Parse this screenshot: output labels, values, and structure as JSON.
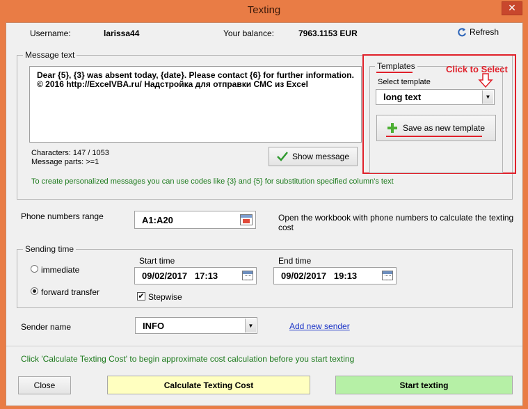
{
  "window": {
    "title": "Texting",
    "close_glyph": "✕"
  },
  "header": {
    "username_label": "Username:",
    "username": "larissa44",
    "balance_label": "Your balance:",
    "balance": "7963.1153 EUR",
    "refresh_label": "Refresh"
  },
  "message": {
    "group_label": "Message text",
    "text": "Dear {5}, {3} was absent today, {date}. Please contact {6} for further information. © 2016 http://ExcelVBA.ru/ Надстройка для отправки СМС из Excel",
    "characters": "Characters: 147 / 1053",
    "parts": "Message parts: >=1",
    "show_button": "Show message",
    "hint": "To create personalized messages you can use codes like {3} and {5} for substitution specified column's text"
  },
  "templates": {
    "group_label": "Templates",
    "select_label": "Select template",
    "selected": "long text",
    "save_button": "Save as new template",
    "annotation": "Click to Select"
  },
  "phones": {
    "label": "Phone numbers range",
    "value": "A1:A20",
    "hint": "Open the workbook with phone numbers to calculate the texting cost"
  },
  "sending": {
    "group_label": "Sending time",
    "immediate": "immediate",
    "forward": "forward transfer",
    "selected": "forward",
    "start_label": "Start time",
    "start_value": "09/02/2017   17:13",
    "end_label": "End time",
    "end_value": "09/02/2017   19:13",
    "stepwise": "Stepwise",
    "stepwise_checked": true
  },
  "sender": {
    "label": "Sender name",
    "value": "INFO",
    "add_link": "Add new sender"
  },
  "footer": {
    "hint": "Click 'Calculate Texting Cost' to begin approximate cost calculation before you start texting",
    "close_button": "Close",
    "calculate_button": "Calculate Texting Cost",
    "start_button": "Start texting"
  },
  "colors": {
    "title_bar": "#e97c45",
    "annotation_red": "#e0202a",
    "calculate_bg": "#ffffc0",
    "start_bg": "#b6f0a6",
    "hint_green": "#1c7a1c"
  },
  "icons": [
    "close-icon",
    "refresh-icon",
    "checkmark-icon",
    "plus-icon",
    "calendar-icon",
    "chevron-down-icon",
    "arrow-down-icon",
    "range-picker-icon"
  ]
}
